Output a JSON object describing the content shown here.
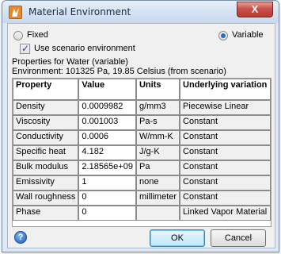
{
  "window": {
    "title": "Material Environment",
    "close_label": "X"
  },
  "options": {
    "fixed_label": "Fixed",
    "variable_label": "Variable",
    "selected": "Variable",
    "use_scenario_label": "Use scenario environment",
    "use_scenario_checked": true
  },
  "info": {
    "properties_for": "Properties for Water (variable)",
    "environment": "Environment: 101325 Pa, 19.85 Celsius (from scenario)"
  },
  "table": {
    "headers": [
      "Property",
      "Value",
      "Units",
      "Underlying variation"
    ],
    "rows": [
      [
        "Density",
        "0.0009982",
        "g/mm3",
        "Piecewise Linear"
      ],
      [
        "Viscosity",
        "0.001003",
        "Pa-s",
        "Constant"
      ],
      [
        "Conductivity",
        "0.0006",
        "W/mm-K",
        "Constant"
      ],
      [
        "Specific heat",
        "4.182",
        "J/g-K",
        "Constant"
      ],
      [
        "Bulk modulus",
        "2.18565e+09",
        "Pa",
        "Constant"
      ],
      [
        "Emissivity",
        "1",
        "none",
        "Constant"
      ],
      [
        "Wall roughness",
        "0",
        "millimeter",
        "Constant"
      ],
      [
        "Phase",
        "0",
        "",
        "Linked Vapor Material"
      ]
    ]
  },
  "buttons": {
    "help_label": "?",
    "ok_label": "OK",
    "cancel_label": "Cancel"
  }
}
